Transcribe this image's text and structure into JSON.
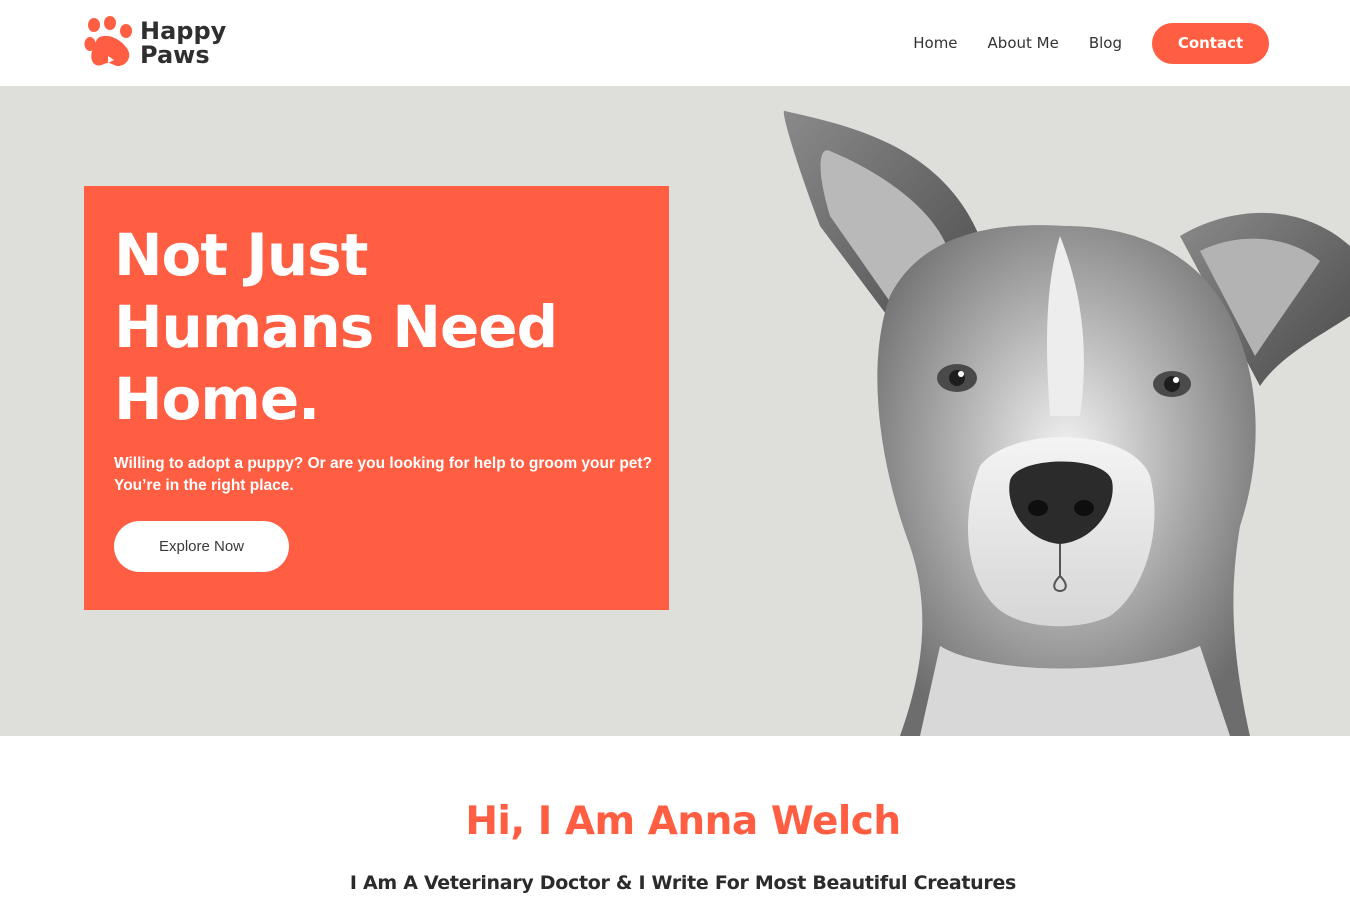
{
  "brand": {
    "line1": "Happy",
    "line2": "Paws",
    "accent_color": "#ff5e43",
    "logo_icon": "paw-icon"
  },
  "nav": {
    "items": [
      "Home",
      "About Me",
      "Blog"
    ],
    "cta": "Contact"
  },
  "hero": {
    "title_lines": [
      "Not Just",
      "Humans Need",
      "Home."
    ],
    "subtitle_line1": "Willing to adopt a puppy? Or are you looking for help to groom your pet?",
    "subtitle_line2": "You’re in the right place.",
    "button": "Explore Now",
    "background_color": "#dededa",
    "image": "dog-portrait-black-and-white"
  },
  "about": {
    "title": "Hi, I Am Anna Welch",
    "subtitle": "I Am A Veterinary Doctor & I Write For Most Beautiful Creatures"
  }
}
